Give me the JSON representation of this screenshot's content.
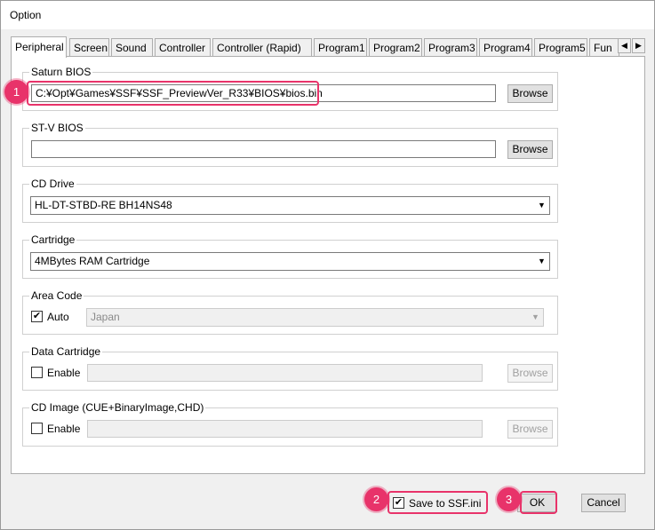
{
  "window": {
    "title": "Option"
  },
  "tabs": [
    {
      "label": "Peripheral",
      "active": true
    },
    {
      "label": "Screen"
    },
    {
      "label": "Sound"
    },
    {
      "label": "Controller"
    },
    {
      "label": "Controller (Rapid)"
    },
    {
      "label": "Program1"
    },
    {
      "label": "Program2"
    },
    {
      "label": "Program3"
    },
    {
      "label": "Program4"
    },
    {
      "label": "Program5"
    },
    {
      "label": "Fun"
    }
  ],
  "tab_scroll": {
    "left": "◀",
    "right": "▶"
  },
  "saturn_bios": {
    "label": "Saturn BIOS",
    "value": "C:¥Opt¥Games¥SSF¥SSF_PreviewVer_R33¥BIOS¥bios.bin",
    "browse": "Browse"
  },
  "stv_bios": {
    "label": "ST-V BIOS",
    "value": "",
    "browse": "Browse"
  },
  "cd_drive": {
    "label": "CD Drive",
    "value": "HL-DT-STBD-RE  BH14NS48"
  },
  "cartridge": {
    "label": "Cartridge",
    "value": "4MBytes RAM Cartridge"
  },
  "area_code": {
    "label": "Area Code",
    "auto_label": "Auto",
    "auto_checked": true,
    "value": "Japan"
  },
  "data_cartridge": {
    "label": "Data Cartridge",
    "enable_label": "Enable",
    "value": "",
    "browse": "Browse"
  },
  "cd_image": {
    "label": "CD Image (CUE+BinaryImage,CHD)",
    "enable_label": "Enable",
    "value": "",
    "browse": "Browse"
  },
  "footer": {
    "save_label": "Save to SSF.ini",
    "save_checked": true,
    "ok": "OK",
    "cancel": "Cancel"
  },
  "annotations": {
    "badge1": "1",
    "badge2": "2",
    "badge3": "3",
    "highlight_color": "#e8336a"
  },
  "icons": {
    "check": "✔",
    "dropdown": "▼"
  }
}
